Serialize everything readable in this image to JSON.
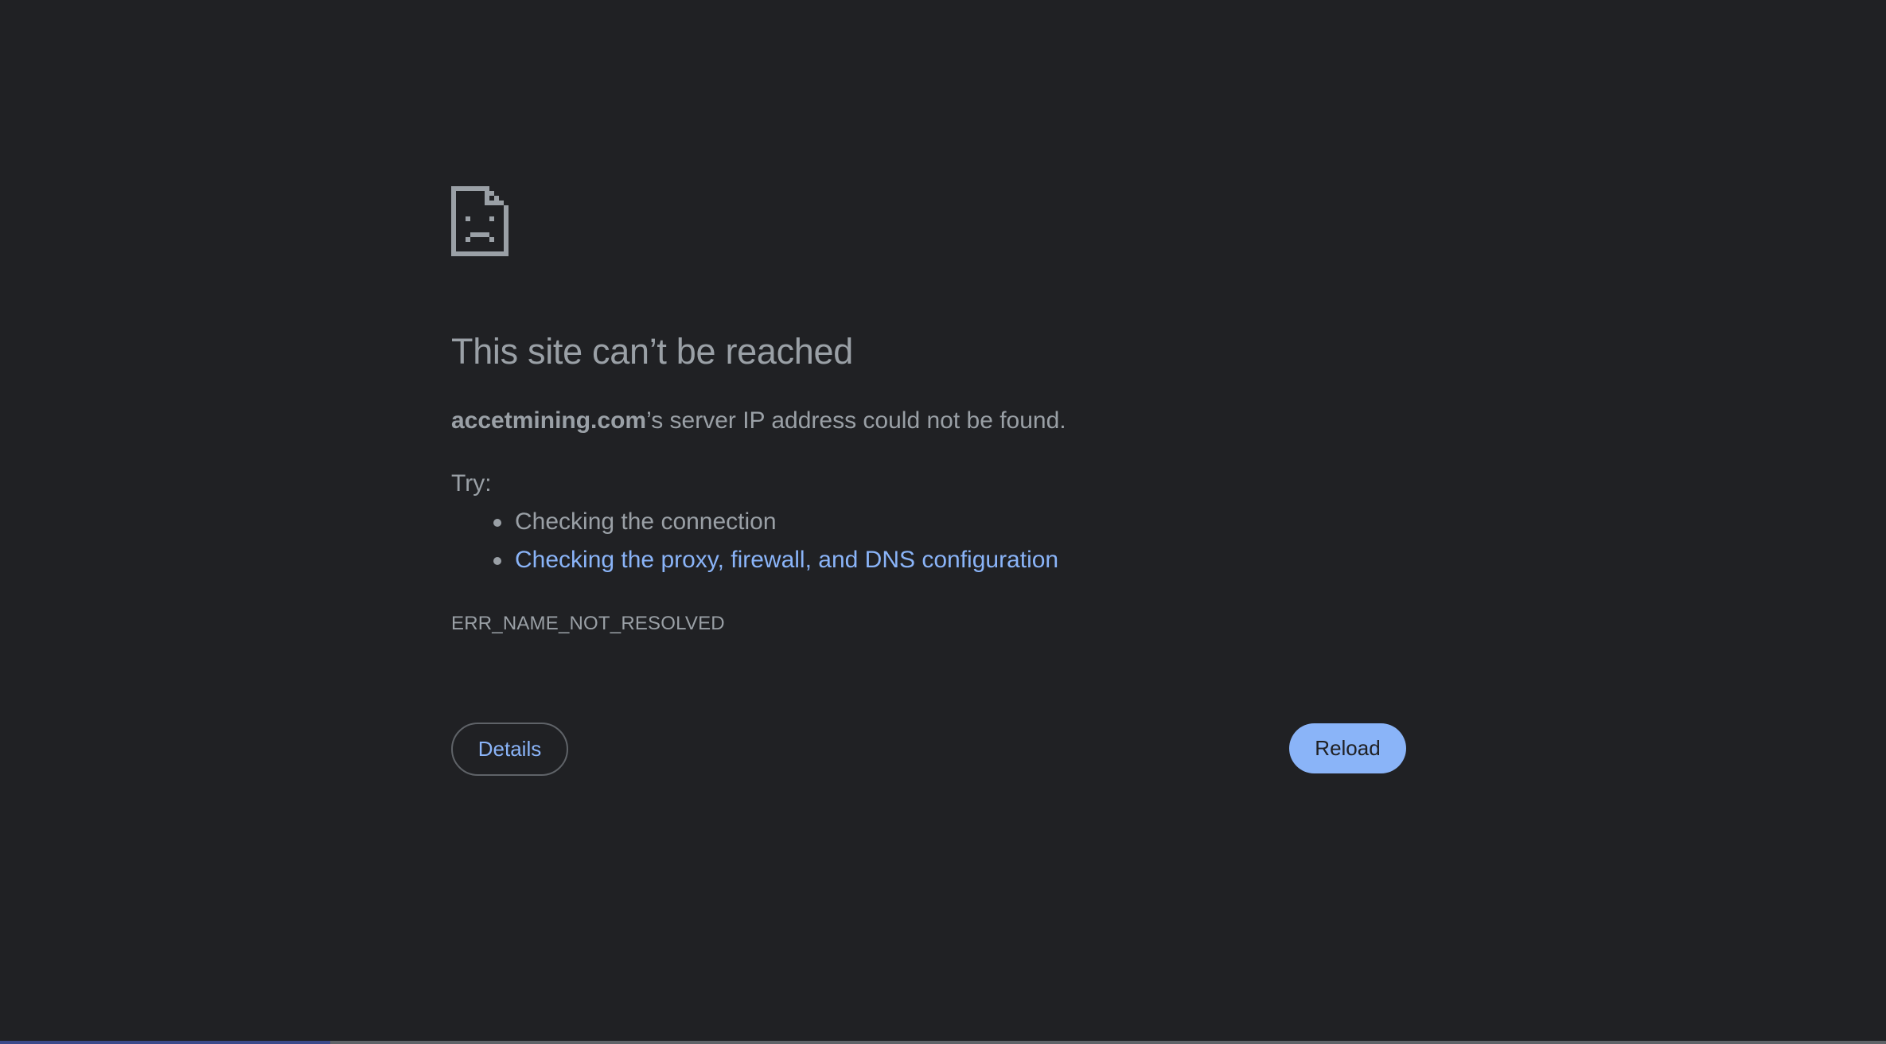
{
  "error_page": {
    "icon": "sad-file-icon",
    "title": "This site can’t be reached",
    "message": {
      "host": "accetmining.com",
      "text": "’s server IP address could not be found."
    },
    "try_label": "Try:",
    "suggestions": [
      {
        "text": "Checking the connection",
        "is_link": false
      },
      {
        "text": "Checking the proxy, firewall, and DNS configuration",
        "is_link": true
      }
    ],
    "error_code": "ERR_NAME_NOT_RESOLVED",
    "buttons": {
      "details_label": "Details",
      "reload_label": "Reload"
    }
  },
  "colors": {
    "background": "#202124",
    "text": "#9aa0a6",
    "link": "#8ab4f8",
    "primary_button": "#8ab4f8",
    "outline": "#5f6368"
  }
}
